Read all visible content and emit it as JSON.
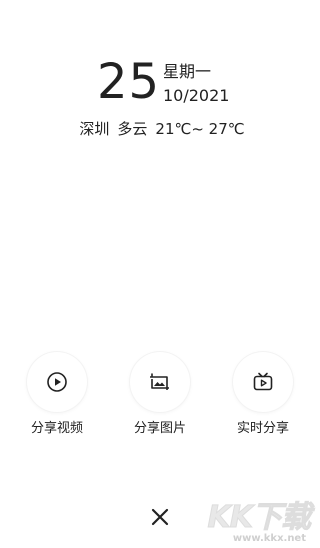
{
  "date": {
    "day": "25",
    "weekday": "星期一",
    "month_year": "10/2021"
  },
  "weather": {
    "city": "深圳",
    "condition": "多云",
    "temperature": "21℃~ 27℃"
  },
  "share_options": [
    {
      "label": "分享视频",
      "icon": "play-circle-icon"
    },
    {
      "label": "分享图片",
      "icon": "image-icon"
    },
    {
      "label": "实时分享",
      "icon": "tv-play-icon"
    }
  ],
  "close": {
    "icon": "close-icon"
  },
  "watermark": {
    "logo": "KK下载",
    "url": "www.kkx.net"
  }
}
